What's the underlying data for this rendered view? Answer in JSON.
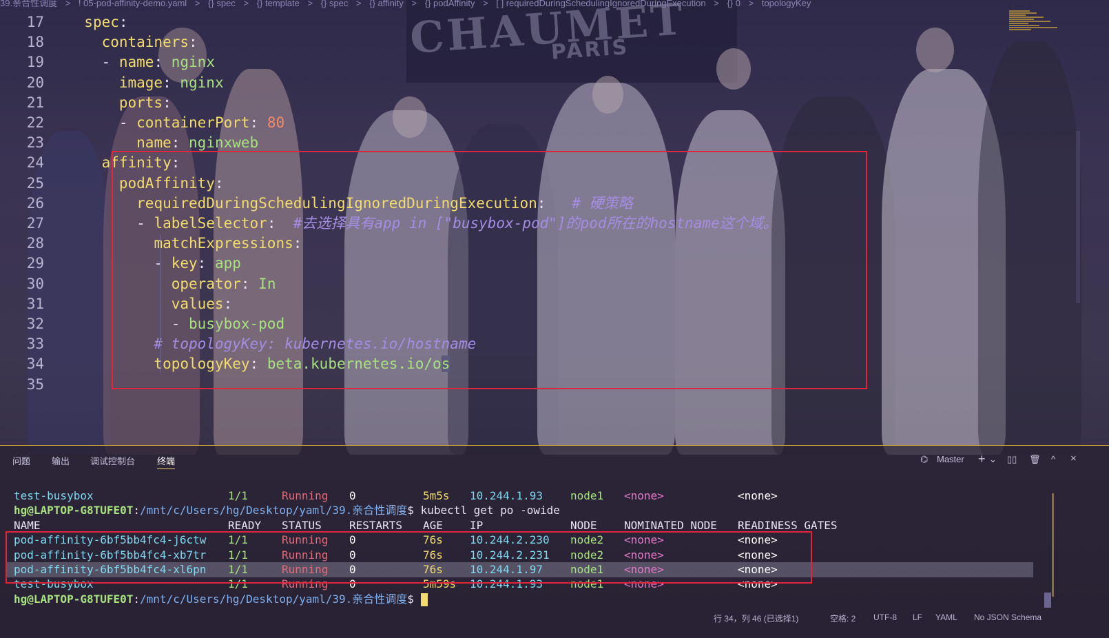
{
  "breadcrumb": [
    "39.亲合性调度",
    ">",
    "! 05-pod-affinity-demo.yaml",
    ">",
    "{} spec",
    ">",
    "{} template",
    ">",
    "{} spec",
    ">",
    "{} affinity",
    ">",
    "{} podAffinity",
    ">",
    "[ ] requiredDuringSchedulingIgnoredDuringExecution",
    ">",
    "{} 0",
    ">",
    "topologyKey"
  ],
  "backdrop": {
    "brand": "CHAUMET",
    "city": "PARIS"
  },
  "editor": {
    "lines": [
      {
        "num": "17",
        "key": "spec",
        "indent": "  "
      },
      {
        "num": "18",
        "key": "containers",
        "indent": "    "
      },
      {
        "num": "19",
        "key": "name",
        "value": "nginx",
        "indent": "    ",
        "dash": true
      },
      {
        "num": "20",
        "key": "image",
        "value": "nginx",
        "indent": "      "
      },
      {
        "num": "21",
        "key": "ports",
        "indent": "      "
      },
      {
        "num": "22",
        "key": "containerPort",
        "value": "80",
        "indent": "      ",
        "dash": true,
        "numeric": true
      },
      {
        "num": "23",
        "key": "name",
        "value": "nginxweb",
        "indent": "        "
      },
      {
        "num": "24",
        "key": "affinity",
        "indent": "    "
      },
      {
        "num": "25",
        "key": "podAffinity",
        "indent": "      "
      },
      {
        "num": "26",
        "key": "requiredDuringSchedulingIgnoredDuringExecution",
        "indent": "        ",
        "comment": "  # 硬策略"
      },
      {
        "num": "27",
        "key": "labelSelector",
        "indent": "        ",
        "dash": true,
        "comment": " #去选择具有app in [\"busybox-pod\"]的pod所在的hostname这个域。"
      },
      {
        "num": "28",
        "key": "matchExpressions",
        "indent": "          "
      },
      {
        "num": "29",
        "key": "key",
        "value": "app",
        "indent": "          ",
        "dash": true
      },
      {
        "num": "30",
        "key": "operator",
        "value": "In",
        "indent": "            "
      },
      {
        "num": "31",
        "key": "values",
        "indent": "            "
      },
      {
        "num": "32",
        "value": "busybox-pod",
        "indent": "            ",
        "dash": true
      },
      {
        "num": "33",
        "indent": "          ",
        "comment": "# topologyKey: kubernetes.io/hostname"
      },
      {
        "num": "34",
        "key": "topologyKey",
        "value": "beta.kubernetes.io/o",
        "cursor_char": "s",
        "indent": "          "
      },
      {
        "num": "35",
        "indent": ""
      }
    ]
  },
  "panel": {
    "tabs": [
      "问题",
      "输出",
      "调试控制台",
      "终端"
    ],
    "active_tab": "终端",
    "terminal_name": "Master",
    "tools": [
      "+",
      "⌄",
      "split",
      "trash",
      "^",
      "×"
    ]
  },
  "terminal": {
    "prompt_user": "hg@LAPTOP-G8TUFE0T",
    "prompt_path": "/mnt/c/Users/hg/Desktop/yaml/39.亲合性调度",
    "prompt_sym": "$",
    "command": "kubectl get po -owide",
    "first_row": {
      "name": "test-busybox",
      "ready": "1/1",
      "status": "Running",
      "restarts": "0",
      "age": "5m5s",
      "ip": "10.244.1.93",
      "node": "node1",
      "nominated": "<none>",
      "gates": "<none>"
    },
    "headers": {
      "name": "NAME",
      "ready": "READY",
      "status": "STATUS",
      "restarts": "RESTARTS",
      "age": "AGE",
      "ip": "IP",
      "node": "NODE",
      "nominated": "NOMINATED NODE",
      "gates": "READINESS GATES"
    },
    "rows": [
      {
        "name": "pod-affinity-6bf5bb4fc4-j6ctw",
        "ready": "1/1",
        "status": "Running",
        "restarts": "0",
        "age": "76s",
        "ip": "10.244.2.230",
        "node": "node2",
        "nominated": "<none>",
        "gates": "<none>"
      },
      {
        "name": "pod-affinity-6bf5bb4fc4-xb7tr",
        "ready": "1/1",
        "status": "Running",
        "restarts": "0",
        "age": "76s",
        "ip": "10.244.2.231",
        "node": "node2",
        "nominated": "<none>",
        "gates": "<none>"
      },
      {
        "name": "pod-affinity-6bf5bb4fc4-xl6pn",
        "ready": "1/1",
        "status": "Running",
        "restarts": "0",
        "age": "76s",
        "ip": "10.244.1.97",
        "node": "node1",
        "nominated": "<none>",
        "gates": "<none>"
      },
      {
        "name": "test-busybox",
        "ready": "1/1",
        "status": "Running",
        "restarts": "0",
        "age": "5m59s",
        "ip": "10.244.1.93",
        "node": "node1",
        "nominated": "<none>",
        "gates": "<none>"
      }
    ]
  },
  "status": {
    "position": "行 34，列 46 (已选择1)",
    "spaces": "空格: 2",
    "encoding": "UTF-8",
    "eol": "LF",
    "language": "YAML",
    "schema": "No JSON Schema"
  },
  "colors": {
    "key": "#f2dc6b",
    "value": "#a7e27f",
    "number": "#f08a6a",
    "comment": "#a48de3",
    "highlight_box": "#e0263a"
  }
}
